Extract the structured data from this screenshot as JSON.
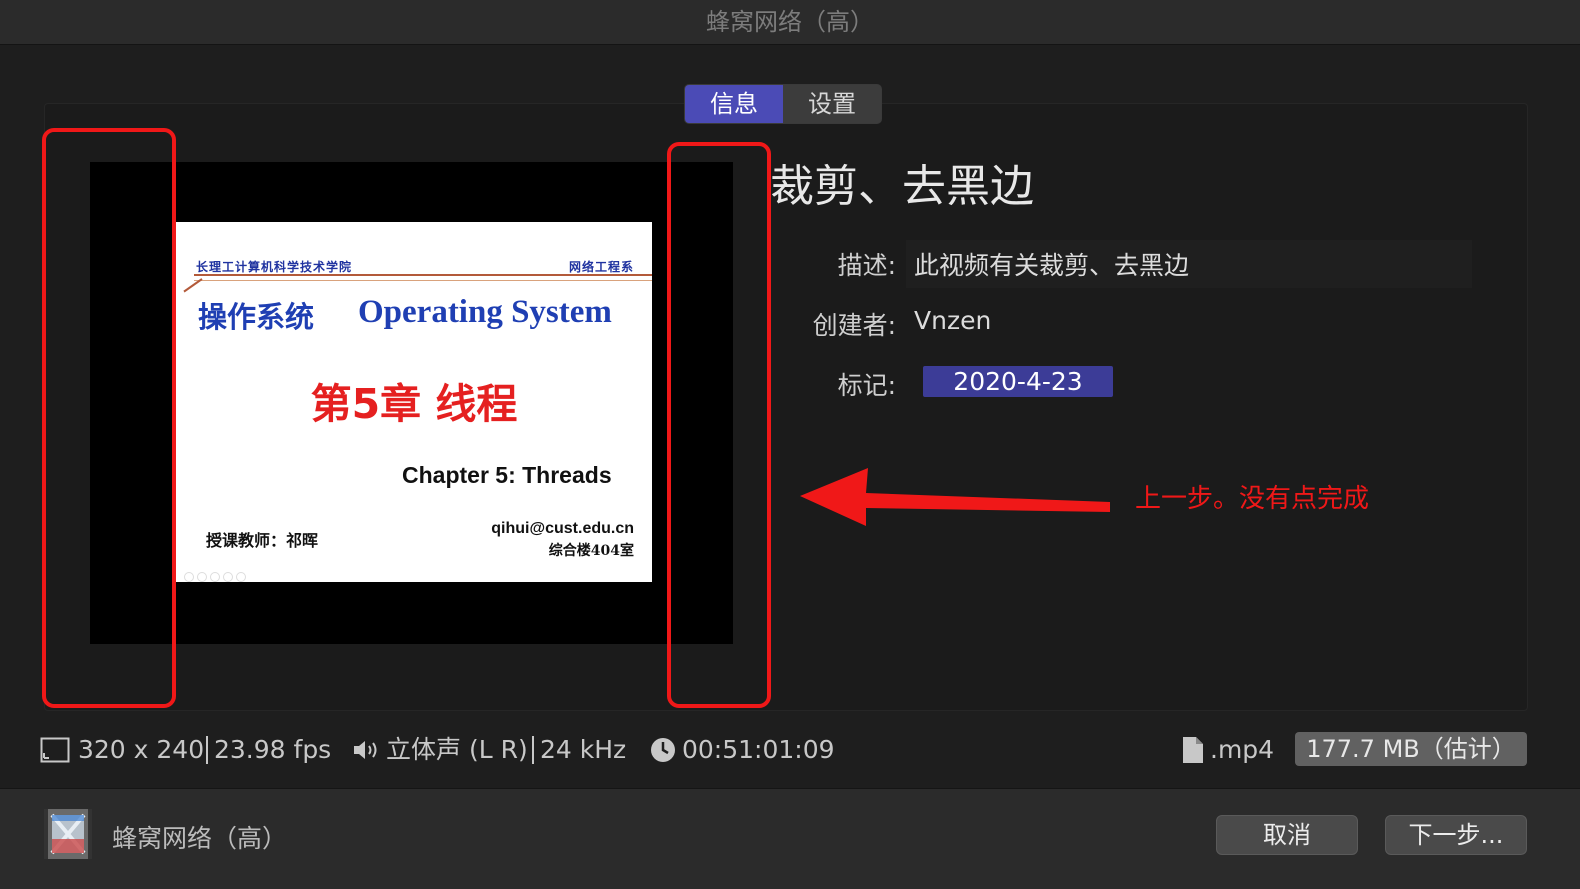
{
  "window": {
    "title": "蜂窝网络（高）"
  },
  "tabs": [
    {
      "label": "信息",
      "active": true
    },
    {
      "label": "设置",
      "active": false
    }
  ],
  "preview": {
    "slide": {
      "college": "长理工计算机科学技术学院",
      "department": "网络工程系",
      "title_cn": "操作系统",
      "title_en": "Operating System",
      "chapter": "第5章 线程",
      "subtitle": "Chapter 5: Threads",
      "teacher": "授课教师：祁晖",
      "email": "qihui@cust.edu.cn",
      "room": "综合楼404室"
    }
  },
  "info": {
    "title": "裁剪、去黑边",
    "fields": [
      {
        "label": "描述:",
        "value": "此视频有关裁剪、去黑边"
      },
      {
        "label": "创建者:",
        "value": "Vnzen"
      },
      {
        "label": "标记:",
        "value": "2020-4-23"
      }
    ]
  },
  "annotation": {
    "text": "上一步。没有点完成",
    "color": "#f01818"
  },
  "status": {
    "resolution": "320 x 240",
    "fps": "23.98 fps",
    "audio": "立体声 (L R)",
    "sample_rate": "24 kHz",
    "duration": "00:51:01:09",
    "format": ".mp4",
    "size": "177.7 MB（估计）"
  },
  "footer": {
    "preset_name": "蜂窝网络（高）",
    "cancel_label": "取消",
    "next_label": "下一步..."
  },
  "colors": {
    "accent": "#4b4bb6",
    "tag_bg": "#3c3c97",
    "annotation_red": "#f01818"
  }
}
